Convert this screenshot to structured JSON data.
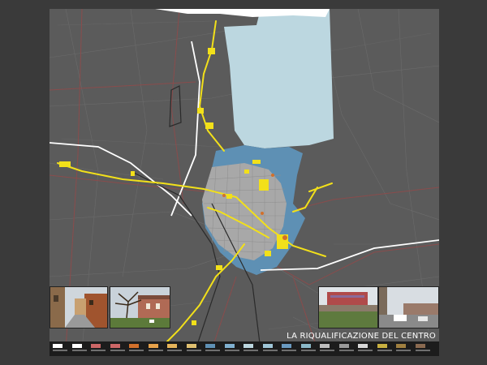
{
  "title": "LA RIQUALIFICAZIONE DEL CENTRO",
  "colors": {
    "background": "#3a3a3a",
    "map_base": "#5b5b5b",
    "water": "#bcd7e0",
    "blue_zone": "#5e90b4",
    "urban_fabric": "#a8a8a8",
    "highlight": "#f2e01a",
    "rail": "#ffffff",
    "roads": "#8a4c4c"
  },
  "legend": {
    "items": [
      {
        "color": "#ffffff"
      },
      {
        "color": "#ffffff"
      },
      {
        "color": "#cc6666"
      },
      {
        "color": "#cc6666"
      },
      {
        "color": "#d2702b"
      },
      {
        "color": "#e8a24a"
      },
      {
        "color": "#e6b45a"
      },
      {
        "color": "#e0c070"
      },
      {
        "color": "#5e90b4"
      },
      {
        "color": "#7fb0d0"
      },
      {
        "color": "#bcd7e0"
      },
      {
        "color": "#9fc6d8"
      },
      {
        "color": "#6a9ac0"
      },
      {
        "color": "#8ab8c8"
      },
      {
        "color": "#bfbfbf"
      },
      {
        "color": "#9a9a9a"
      },
      {
        "color": "#d8d8d8"
      },
      {
        "color": "#c8b040"
      },
      {
        "color": "#a08040"
      },
      {
        "color": "#8a6a50"
      }
    ]
  },
  "photos": [
    {
      "name": "photo-street"
    },
    {
      "name": "photo-building-tree"
    },
    {
      "name": "photo-field-building"
    },
    {
      "name": "photo-parking"
    }
  ]
}
